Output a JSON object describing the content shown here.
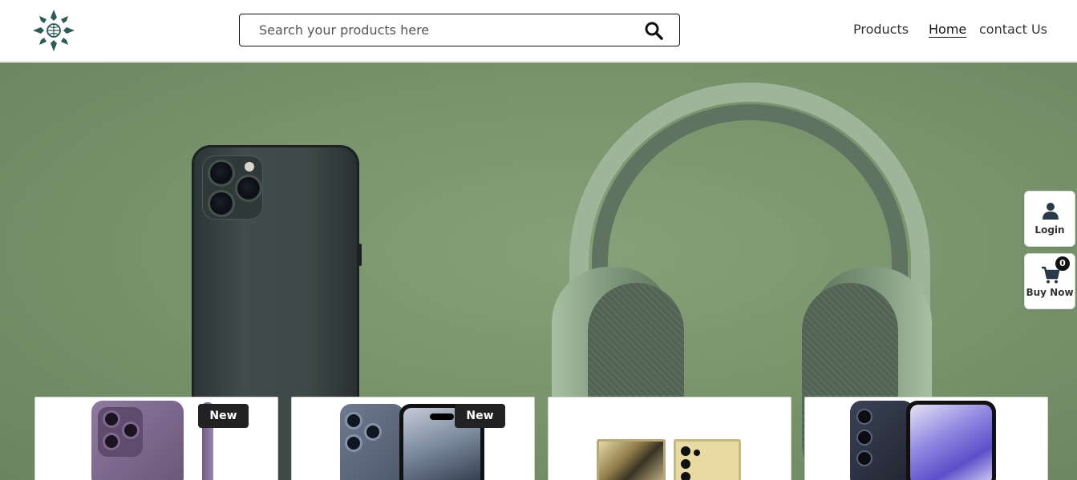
{
  "header": {
    "logo_icon": "compass-star-logo-icon",
    "search": {
      "placeholder": "Search your products here",
      "icon": "search-icon"
    },
    "nav": {
      "products": "Products",
      "home": "Home",
      "contact": "contact Us"
    }
  },
  "hero": {
    "image": "hero-phone-headphones-image",
    "colors": {
      "background": "#7a946d"
    }
  },
  "side_widgets": {
    "login_label": "Login",
    "buy_label": "Buy Now",
    "cart_count": "0"
  },
  "products": [
    {
      "badge": "New"
    },
    {
      "badge": "New"
    },
    {
      "badge": ""
    },
    {
      "badge": ""
    }
  ]
}
